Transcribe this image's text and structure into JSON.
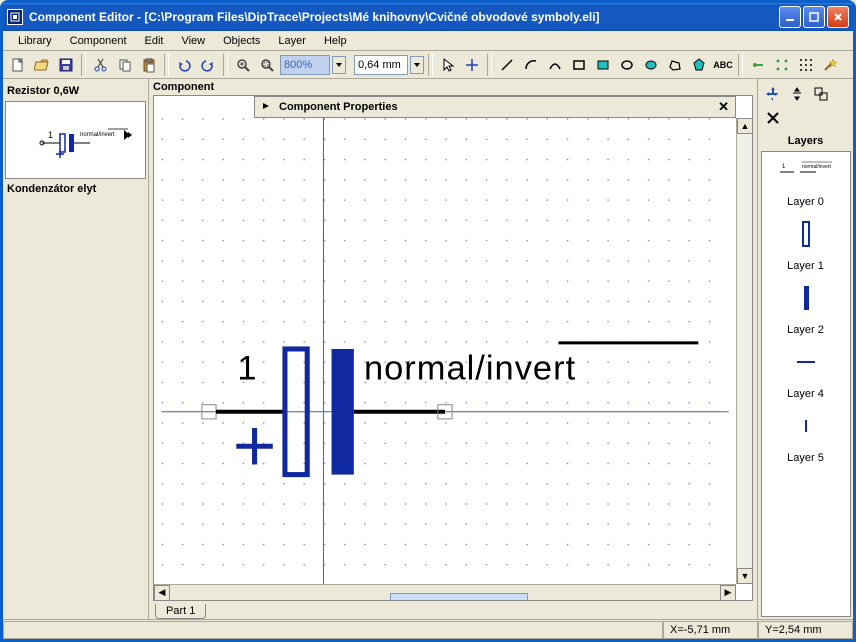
{
  "title": "Component Editor - [C:\\Program Files\\DipTrace\\Projects\\Mé knihovny\\Cvičné obvodové symboly.eli]",
  "menubar": [
    "Library",
    "Component",
    "Edit",
    "View",
    "Objects",
    "Layer",
    "Help"
  ],
  "toolbar": {
    "zoom": "800%",
    "grid": "0,64 mm"
  },
  "lib": {
    "item1": "Rezistor 0,6W",
    "item2": "Kondenzátor elyt",
    "preview_pin": "1",
    "preview_label": "normal/invert"
  },
  "canvas": {
    "title": "Component",
    "properties": "Component Properties",
    "pin_number": "1",
    "net_label": "normal/invert"
  },
  "tabs": {
    "part1": "Part 1"
  },
  "right": {
    "title": "Layers",
    "layers": [
      "Layer 0",
      "Layer 1",
      "Layer 2",
      "Layer 4",
      "Layer 5"
    ]
  },
  "status": {
    "x": "X=-5,71 mm",
    "y": "Y=2,54 mm"
  },
  "icons": {
    "new": "new-icon",
    "open": "open-icon",
    "save": "save-icon",
    "cut": "cut-icon",
    "copy": "copy-icon",
    "paste": "paste-icon",
    "undo": "undo-icon",
    "redo": "redo-icon",
    "zoomin": "zoom-in-icon",
    "zoomwin": "zoom-window-icon",
    "pointer": "pointer-icon",
    "origin": "origin-icon",
    "line": "line-icon",
    "arc2": "arc-icon",
    "arc3": "arc3-icon",
    "rect": "rect-icon",
    "rectf": "rect-filled-icon",
    "ellipse": "ellipse-icon",
    "ellipsef": "ellipse-filled-icon",
    "poly": "poly-icon",
    "polyf": "poly-filled-icon",
    "text": "text-icon",
    "pin": "pin-icon",
    "pins": "pin-array-icon",
    "grid": "grid-dense-icon",
    "wizard": "wizard-icon"
  }
}
